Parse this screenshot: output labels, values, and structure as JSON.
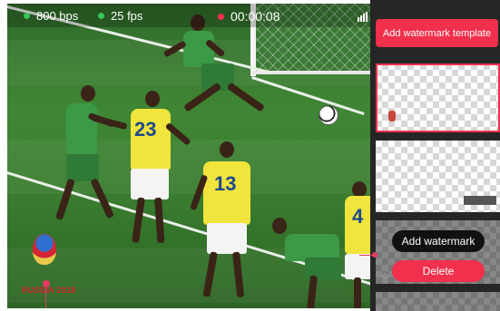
{
  "status": {
    "bitrate": "800 bps",
    "fps": "25 fps",
    "recording_time": "00:00:08",
    "dot_color_ok": "#34c759",
    "dot_color_rec": "#ff2d55"
  },
  "video": {
    "logo_text": "RUSSIA 2018",
    "jersey_numbers": [
      "23",
      "13",
      "4"
    ]
  },
  "panel": {
    "add_template_label": "Add watermark template",
    "add_watermark_label": "Add watermark",
    "delete_label": "Delete",
    "accent_color": "#f0304c"
  }
}
